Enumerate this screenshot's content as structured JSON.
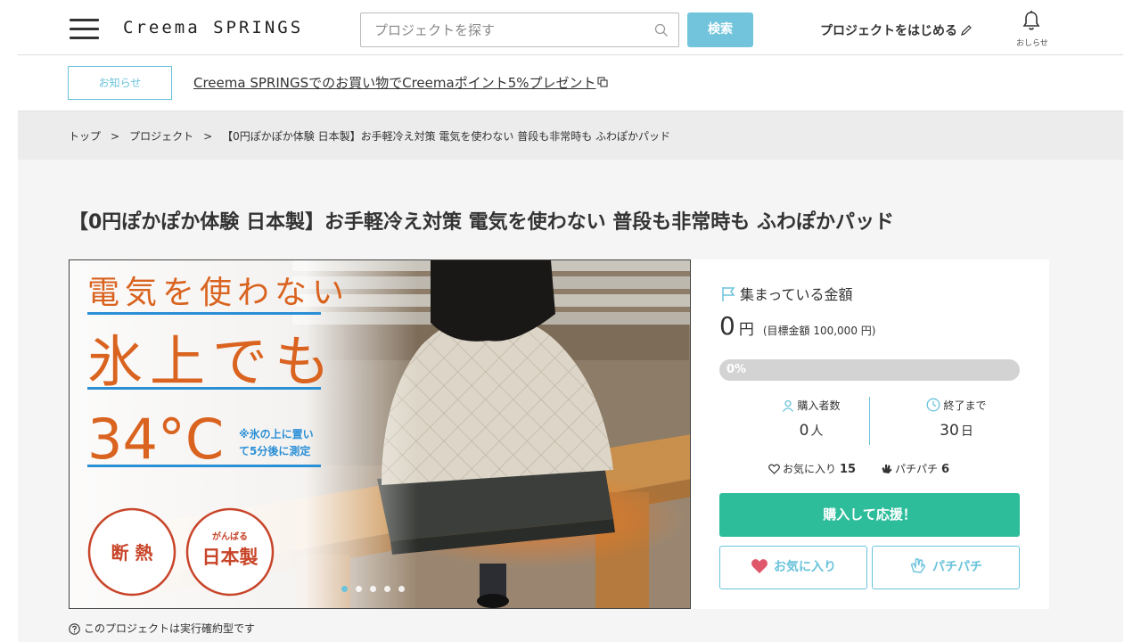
{
  "header": {
    "logo": "Creema SPRINGS",
    "search_placeholder": "プロジェクトを探す",
    "search_button": "検索",
    "start_project": "プロジェクトをはじめる",
    "notifications_label": "おしらせ"
  },
  "notice": {
    "badge": "お知らせ",
    "link_text": "Creema SPRINGSでのお買い物でCreemaポイント5%プレゼント"
  },
  "breadcrumb": {
    "home": "トップ",
    "projects": "プロジェクト",
    "current": "【0円ぽかぽか体験 日本製】お手軽冷え対策 電気を使わない 普段も非常時も ふわぽかパッド",
    "separator": ">"
  },
  "project": {
    "title": "【0円ぽかぽか体験 日本製】お手軽冷え対策 電気を使わない 普段も非常時も ふわぽかパッド",
    "hero": {
      "line1": "電気を使わない",
      "line2": "氷上でも",
      "line3": "34°C",
      "note_line1": "※氷の上に置い",
      "note_line2": "て5分後に測定",
      "badge1": "断 熱",
      "badge2_small": "がんばる",
      "badge2_main": "日本製",
      "slide_count": 5,
      "active_slide": 0
    },
    "funding": {
      "label": "集まっている金額",
      "amount": "0",
      "currency": "円",
      "goal_text": "(目標金額 100,000 円)",
      "progress_percent": 0,
      "progress_text": "0%"
    },
    "stats": {
      "buyers_label": "購入者数",
      "buyers_value": "0",
      "buyers_unit": "人",
      "remaining_label": "終了まで",
      "remaining_value": "30",
      "remaining_unit": "日"
    },
    "social": {
      "favorites_label": "お気に入り",
      "favorites_count": "15",
      "clap_label": "パチパチ",
      "clap_count": "6"
    },
    "buttons": {
      "buy": "購入して応援！",
      "favorite": "お気に入り",
      "clap": "パチパチ"
    },
    "footnote": "このプロジェクトは実行確約型です"
  },
  "colors": {
    "accent": "#6bc3db",
    "buy_green": "#2ebd9b",
    "hero_orange": "#d9631f",
    "hero_blue": "#2b8fd6",
    "badge_red": "#c8452a"
  }
}
